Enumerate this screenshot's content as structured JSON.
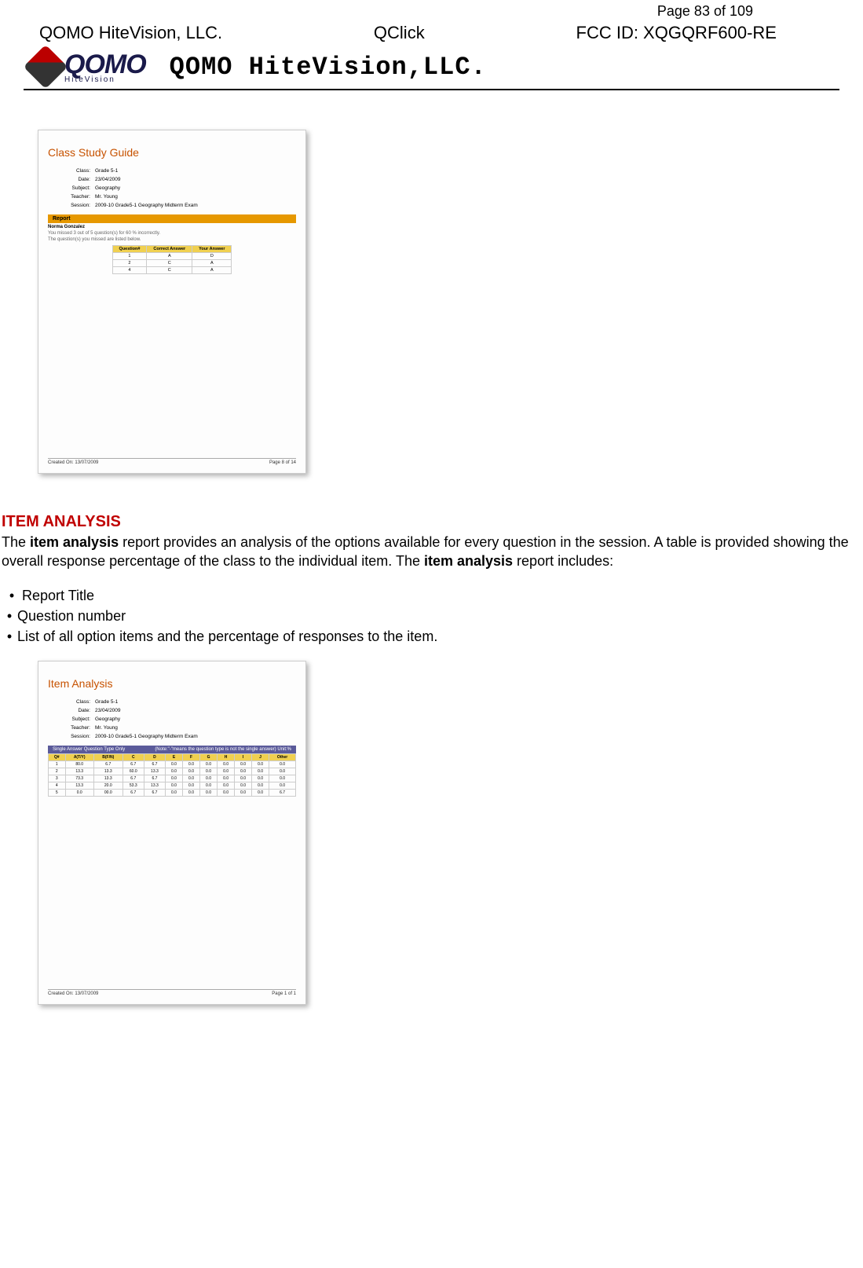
{
  "page_info": {
    "label": "Page 83 of 109"
  },
  "header": {
    "left": "QOMO HiteVision, LLC.",
    "center": "QClick",
    "right": "FCC ID: XQGQRF600-RE",
    "logo_text": "QOMO",
    "logo_sub": "HiteVision",
    "title": "QOMO HiteVision,LLC."
  },
  "shot1": {
    "title": "Class Study Guide",
    "fields": {
      "class_lbl": "Class:",
      "class_val": "Grade 5-1",
      "date_lbl": "Date:",
      "date_val": "23/04/2009",
      "subject_lbl": "Subject:",
      "subject_val": "Geography",
      "teacher_lbl": "Teacher:",
      "teacher_val": "Mr. Young",
      "session_lbl": "Session:",
      "session_val": "2009-10 Grade5-1 Geography Midterm Exam"
    },
    "report_bar": "Report",
    "student": "Norma Gonzalez",
    "note1": "You missed 3 out of 5 question(s) for 60 % incorrectly.",
    "note2": "The question(s) you missed are listed below.",
    "headers": [
      "Question#",
      "Correct Answer",
      "Your Answer"
    ],
    "rows": [
      [
        "1",
        "A",
        "D"
      ],
      [
        "2",
        "C",
        "A"
      ],
      [
        "4",
        "C",
        "A"
      ]
    ],
    "footer_left": "Created On: 13/07/2009",
    "footer_right": "Page 8 of 14"
  },
  "section": {
    "heading": "ITEM ANALYSIS",
    "para_parts": {
      "p1": "The ",
      "b1": "item analysis",
      "p2": " report provides an analysis of the options available for every question in the session. A table is provided showing the overall response percentage of the class to the individual item. The ",
      "b2": "item analysis",
      "p3": " report includes:"
    },
    "bullets": [
      "Report Title",
      "Question number",
      "List of all option items and the percentage of responses to the item."
    ]
  },
  "shot2": {
    "title": "Item Analysis",
    "fields": {
      "class_lbl": "Class:",
      "class_val": "Grade 5-1",
      "date_lbl": "Date:",
      "date_val": "23/04/2009",
      "subject_lbl": "Subject:",
      "subject_val": "Geography",
      "teacher_lbl": "Teacher:",
      "teacher_val": "Mr. Young",
      "session_lbl": "Session:",
      "session_val": "2009-10 Grade5-1 Geography Midterm Exam"
    },
    "bar_left": "Single Answer Question Type Only",
    "bar_right": "(Note:\"-\"means the question type is not the single answer)   Unit:%",
    "headers": [
      "Q#",
      "A(T/Y)",
      "B(F/N)",
      "C",
      "D",
      "E",
      "F",
      "G",
      "H",
      "I",
      "J",
      "Other"
    ],
    "rows": [
      [
        "1",
        "80.0",
        "6.7",
        "6.7",
        "6.7",
        "0.0",
        "0.0",
        "0.0",
        "0.0",
        "0.0",
        "0.0",
        "0.0"
      ],
      [
        "2",
        "13.3",
        "13.3",
        "60.0",
        "13.3",
        "0.0",
        "0.0",
        "0.0",
        "0.0",
        "0.0",
        "0.0",
        "0.0"
      ],
      [
        "3",
        "73.3",
        "13.3",
        "6.7",
        "6.7",
        "0.0",
        "0.0",
        "0.0",
        "0.0",
        "0.0",
        "0.0",
        "0.0"
      ],
      [
        "4",
        "13.3",
        "20.0",
        "53.3",
        "13.3",
        "0.0",
        "0.0",
        "0.0",
        "0.0",
        "0.0",
        "0.0",
        "0.0"
      ],
      [
        "5",
        "0.0",
        "00.0",
        "6.7",
        "6.7",
        "0.0",
        "0.0",
        "0.0",
        "0.0",
        "0.0",
        "0.0",
        "6.7"
      ]
    ],
    "footer_left": "Created On: 13/07/2009",
    "footer_right": "Page 1 of 1"
  }
}
